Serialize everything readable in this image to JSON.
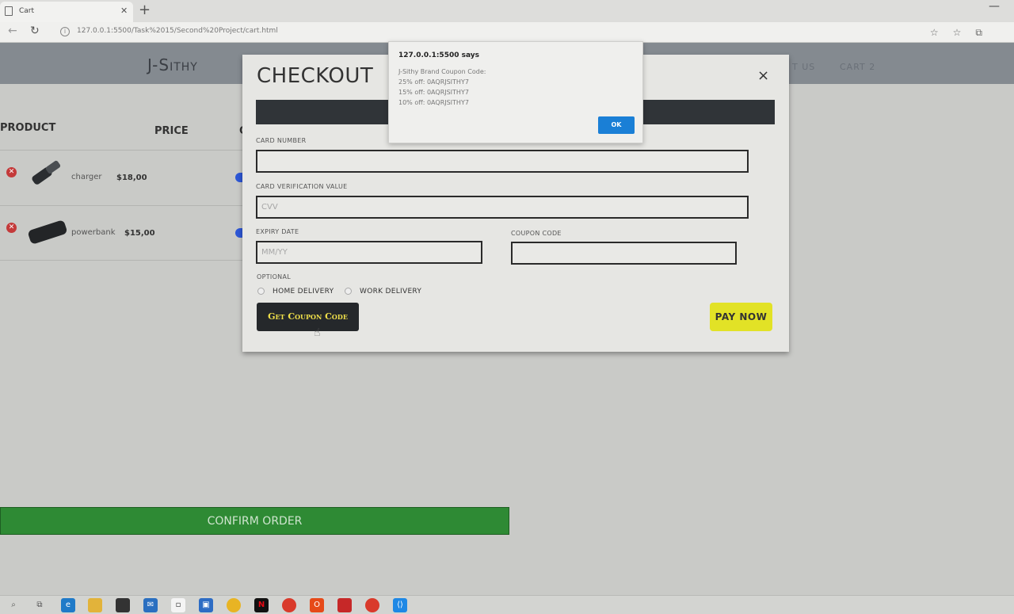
{
  "browser": {
    "tab_title": "Cart",
    "url": "127.0.0.1:5500/Task%2015/Second%20Project/cart.html"
  },
  "site": {
    "brand": "J-Sithy",
    "nav_contact": "T US",
    "nav_cart": "CART 2"
  },
  "cart": {
    "headers": {
      "product": "PRODUCT",
      "price": "PRICE",
      "qty": "Q"
    },
    "items": [
      {
        "name": "charger",
        "price": "$18,00"
      },
      {
        "name": "powerbank",
        "price": "$15,00"
      }
    ],
    "confirm_label": "CONFIRM ORDER"
  },
  "modal": {
    "title": "CHECKOUT",
    "close": "×",
    "card_number_label": "CARD NUMBER",
    "cvv_label": "CARD VERIFICATION VALUE",
    "cvv_placeholder": "CVV",
    "expiry_label": "EXPIRY DATE",
    "expiry_placeholder": "MM/YY",
    "coupon_label": "COUPON CODE",
    "optional_label": "OPTIONAL",
    "home_delivery": "HOME DELIVERY",
    "work_delivery": "WORK DELIVERY",
    "coupon_button": "Get Coupon Code",
    "pay_button": "PAY NOW"
  },
  "alert": {
    "title": "127.0.0.1:5500 says",
    "lines": [
      "J-Sithy Brand Coupon Code:",
      "25% off: 0AQRJSITHY7",
      "15% off: 0AQRJSITHY7",
      "10% off: 0AQRJSITHY7"
    ],
    "ok": "OK"
  },
  "colors": {
    "header": "#848a90",
    "confirm": "#2e8a34",
    "pay": "#e2e226",
    "ok_button": "#1a7fd6"
  },
  "taskbar": {
    "icons": [
      "search-icon",
      "task-view-icon",
      "edge-icon",
      "file-explorer-icon",
      "store-icon",
      "mail-icon",
      "app-icon",
      "app-icon",
      "chrome-icon",
      "netflix-icon",
      "chrome-icon",
      "office-icon",
      "pdf-icon",
      "chrome-profile-icon",
      "vscode-icon"
    ]
  }
}
